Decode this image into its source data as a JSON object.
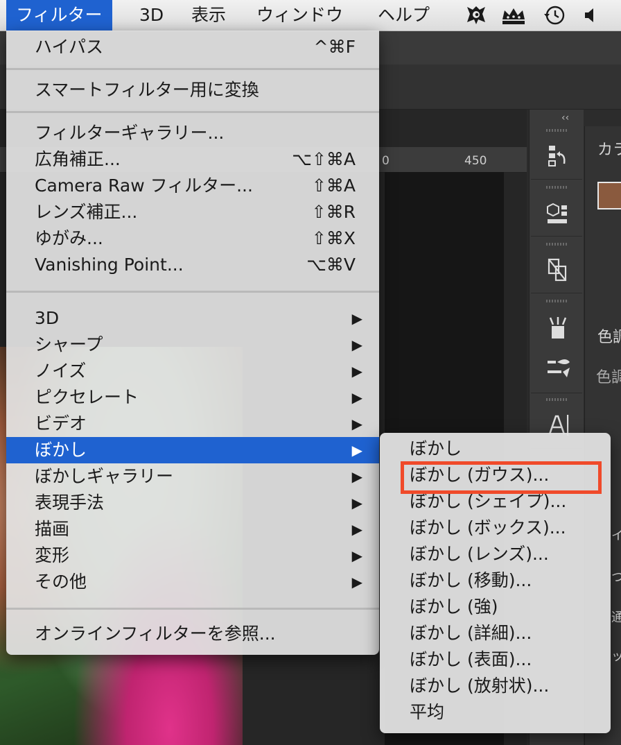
{
  "menubar": {
    "items": [
      {
        "label": "フィルター",
        "active": true
      },
      {
        "label": "3D"
      },
      {
        "label": "表示"
      },
      {
        "label": "ウィンドウ"
      },
      {
        "label": "ヘルプ"
      }
    ],
    "status_icons": [
      "creative-cloud-icon",
      "crown-icon",
      "time-machine-icon",
      "volume-icon"
    ]
  },
  "background": {
    "ruler_ticks": [
      "0",
      "450"
    ],
    "panel_labels": {
      "color": "カラ",
      "adjust1": "色調",
      "adjust2": "色調",
      "small_a": "イ",
      "small_b": "つ",
      "small_c": "通常",
      "small_d": "ッ"
    }
  },
  "filter_menu": {
    "groups": [
      [
        {
          "label": "ハイパス",
          "shortcut": "^⌘F"
        }
      ],
      [
        {
          "label": "スマートフィルター用に変換",
          "shortcut": ""
        }
      ],
      [
        {
          "label": "フィルターギャラリー...",
          "shortcut": ""
        },
        {
          "label": "広角補正...",
          "shortcut": "⌥⇧⌘A"
        },
        {
          "label": "Camera Raw フィルター...",
          "shortcut": "⇧⌘A"
        },
        {
          "label": "レンズ補正...",
          "shortcut": "⇧⌘R"
        },
        {
          "label": "ゆがみ...",
          "shortcut": "⇧⌘X"
        },
        {
          "label": "Vanishing Point...",
          "shortcut": "⌥⌘V"
        }
      ],
      [
        {
          "label": "3D",
          "submenu": true
        },
        {
          "label": "シャープ",
          "submenu": true
        },
        {
          "label": "ノイズ",
          "submenu": true
        },
        {
          "label": "ピクセレート",
          "submenu": true
        },
        {
          "label": "ビデオ",
          "submenu": true
        },
        {
          "label": "ぼかし",
          "submenu": true,
          "highlighted": true
        },
        {
          "label": "ぼかしギャラリー",
          "submenu": true
        },
        {
          "label": "表現手法",
          "submenu": true
        },
        {
          "label": "描画",
          "submenu": true
        },
        {
          "label": "変形",
          "submenu": true
        },
        {
          "label": "その他",
          "submenu": true
        }
      ],
      [
        {
          "label": "オンラインフィルターを参照...",
          "shortcut": ""
        }
      ]
    ]
  },
  "blur_submenu": {
    "items": [
      "ぼかし",
      "ぼかし (ガウス)...",
      "ぼかし (シェイプ)...",
      "ぼかし (ボックス)...",
      "ぼかし (レンズ)...",
      "ぼかし (移動)...",
      "ぼかし (強)",
      "ぼかし (詳細)...",
      "ぼかし (表面)...",
      "ぼかし (放射状)...",
      "平均"
    ],
    "callout_color": "#f04a2a"
  },
  "colors": {
    "accent": "#1f62d0",
    "foreground_swatch": "#8a5a3e"
  }
}
